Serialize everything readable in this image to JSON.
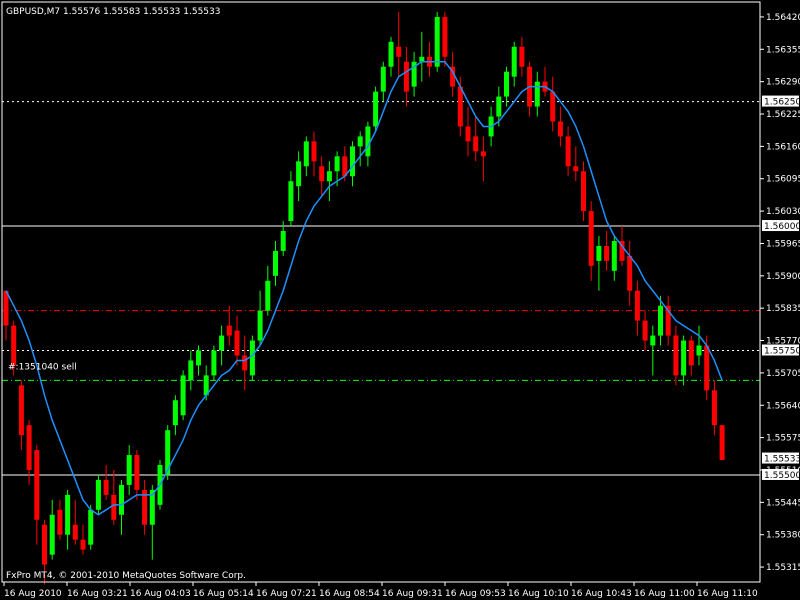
{
  "header": {
    "symbol": "GBPUSD,M7",
    "quote": "1.55576 1.55583 1.55533 1.55533"
  },
  "footer": {
    "copyright": "FxPro MT4, © 2001-2010 MetaQuotes Software Corp."
  },
  "colors": {
    "background": "#000000",
    "bull": "#00ff00",
    "bear": "#ff0000",
    "ma": "#1e90ff",
    "axis": "#ffffff",
    "order_stop": "#ff0000",
    "order_target": "#00ff00"
  },
  "chart_data": {
    "type": "candlestick",
    "symbol": "GBPUSD",
    "timeframe": "M7",
    "ylim": [
      1.555,
      1.5645
    ],
    "y_ticks": [
      "1.56420",
      "1.56355",
      "1.56290",
      "1.56225",
      "1.56160",
      "1.56095",
      "1.56030",
      "1.55965",
      "1.55900",
      "1.55835",
      "1.55770",
      "1.55705",
      "1.55640",
      "1.55575",
      "1.55510",
      "1.55445",
      "1.55380",
      "1.55315"
    ],
    "x_ticks": [
      "16 Aug 2010",
      "16 Aug 03:21",
      "16 Aug 04:03",
      "16 Aug 05:14",
      "16 Aug 07:21",
      "16 Aug 08:54",
      "16 Aug 09:31",
      "16 Aug 09:53",
      "16 Aug 10:10",
      "16 Aug 10:43",
      "16 Aug 11:00",
      "16 Aug 11:10"
    ],
    "price_labels": [
      {
        "text": "1.56250",
        "price": 1.5625,
        "style": "boxed"
      },
      {
        "text": "1.56000",
        "price": 1.56,
        "style": "boxed"
      },
      {
        "text": "1.55750",
        "price": 1.5575,
        "style": "boxed"
      },
      {
        "text": "1.55533",
        "price": 1.55533,
        "style": "boxed"
      },
      {
        "text": "1.55500",
        "price": 1.555,
        "style": "boxed"
      }
    ],
    "hlines": [
      {
        "price": 1.5625,
        "style": "dotted",
        "color": "#ffffff"
      },
      {
        "price": 1.56,
        "style": "solid",
        "color": "#ffffff"
      },
      {
        "price": 1.5583,
        "style": "dashdot",
        "color": "#ff0000"
      },
      {
        "price": 1.5575,
        "style": "dotted",
        "color": "#ffffff"
      },
      {
        "price": 1.5569,
        "style": "dashdot",
        "color": "#00ff00"
      },
      {
        "price": 1.555,
        "style": "solid",
        "color": "#ffffff"
      }
    ],
    "order_label": {
      "text": "#:1351040 sell",
      "price": 1.5571
    },
    "candles": [
      {
        "o": 1.5587,
        "h": 1.5587,
        "l": 1.5577,
        "c": 1.558
      },
      {
        "o": 1.558,
        "h": 1.5581,
        "l": 1.557,
        "c": 1.5572
      },
      {
        "o": 1.5568,
        "h": 1.5569,
        "l": 1.5555,
        "c": 1.5558
      },
      {
        "o": 1.556,
        "h": 1.5561,
        "l": 1.5548,
        "c": 1.5551
      },
      {
        "o": 1.5555,
        "h": 1.5556,
        "l": 1.5536,
        "c": 1.5541
      },
      {
        "o": 1.554,
        "h": 1.5541,
        "l": 1.5528,
        "c": 1.5532
      },
      {
        "o": 1.5534,
        "h": 1.5545,
        "l": 1.5533,
        "c": 1.5542
      },
      {
        "o": 1.5543,
        "h": 1.5545,
        "l": 1.5537,
        "c": 1.5538
      },
      {
        "o": 1.5538,
        "h": 1.5547,
        "l": 1.5535,
        "c": 1.5546
      },
      {
        "o": 1.554,
        "h": 1.5545,
        "l": 1.5536,
        "c": 1.5537
      },
      {
        "o": 1.5537,
        "h": 1.554,
        "l": 1.5534,
        "c": 1.5535
      },
      {
        "o": 1.5536,
        "h": 1.5544,
        "l": 1.5535,
        "c": 1.5543
      },
      {
        "o": 1.5543,
        "h": 1.555,
        "l": 1.5542,
        "c": 1.5549
      },
      {
        "o": 1.5549,
        "h": 1.5552,
        "l": 1.5545,
        "c": 1.5546
      },
      {
        "o": 1.5546,
        "h": 1.5551,
        "l": 1.554,
        "c": 1.5541
      },
      {
        "o": 1.5542,
        "h": 1.5549,
        "l": 1.5538,
        "c": 1.5548
      },
      {
        "o": 1.5548,
        "h": 1.5556,
        "l": 1.5546,
        "c": 1.5554
      },
      {
        "o": 1.5554,
        "h": 1.5555,
        "l": 1.5545,
        "c": 1.5547
      },
      {
        "o": 1.5547,
        "h": 1.5549,
        "l": 1.5538,
        "c": 1.554
      },
      {
        "o": 1.554,
        "h": 1.5548,
        "l": 1.5533,
        "c": 1.5547
      },
      {
        "o": 1.5544,
        "h": 1.5553,
        "l": 1.5543,
        "c": 1.5552
      },
      {
        "o": 1.555,
        "h": 1.556,
        "l": 1.5549,
        "c": 1.5559
      },
      {
        "o": 1.556,
        "h": 1.5566,
        "l": 1.5558,
        "c": 1.5565
      },
      {
        "o": 1.5562,
        "h": 1.5571,
        "l": 1.5561,
        "c": 1.557
      },
      {
        "o": 1.5569,
        "h": 1.5575,
        "l": 1.5567,
        "c": 1.5573
      },
      {
        "o": 1.5572,
        "h": 1.5576,
        "l": 1.557,
        "c": 1.5575
      },
      {
        "o": 1.5566,
        "h": 1.5572,
        "l": 1.5565,
        "c": 1.557
      },
      {
        "o": 1.557,
        "h": 1.5576,
        "l": 1.5569,
        "c": 1.5575
      },
      {
        "o": 1.5575,
        "h": 1.558,
        "l": 1.5572,
        "c": 1.5578
      },
      {
        "o": 1.558,
        "h": 1.5584,
        "l": 1.5576,
        "c": 1.5578
      },
      {
        "o": 1.5579,
        "h": 1.5582,
        "l": 1.5572,
        "c": 1.5574
      },
      {
        "o": 1.5574,
        "h": 1.5578,
        "l": 1.5567,
        "c": 1.5571
      },
      {
        "o": 1.557,
        "h": 1.5578,
        "l": 1.5569,
        "c": 1.5577
      },
      {
        "o": 1.5577,
        "h": 1.5587,
        "l": 1.5576,
        "c": 1.5583
      },
      {
        "o": 1.5583,
        "h": 1.5592,
        "l": 1.5582,
        "c": 1.5589
      },
      {
        "o": 1.559,
        "h": 1.5597,
        "l": 1.5588,
        "c": 1.5595
      },
      {
        "o": 1.5595,
        "h": 1.5601,
        "l": 1.5594,
        "c": 1.5599
      },
      {
        "o": 1.5601,
        "h": 1.5611,
        "l": 1.56,
        "c": 1.5609
      },
      {
        "o": 1.5608,
        "h": 1.5615,
        "l": 1.5605,
        "c": 1.5613
      },
      {
        "o": 1.5612,
        "h": 1.5618,
        "l": 1.561,
        "c": 1.5617
      },
      {
        "o": 1.5617,
        "h": 1.5619,
        "l": 1.561,
        "c": 1.5613
      },
      {
        "o": 1.5612,
        "h": 1.5614,
        "l": 1.5606,
        "c": 1.5609
      },
      {
        "o": 1.5609,
        "h": 1.5613,
        "l": 1.5605,
        "c": 1.5611
      },
      {
        "o": 1.5611,
        "h": 1.5615,
        "l": 1.5608,
        "c": 1.5614
      },
      {
        "o": 1.5614,
        "h": 1.5616,
        "l": 1.5609,
        "c": 1.561
      },
      {
        "o": 1.561,
        "h": 1.5617,
        "l": 1.5608,
        "c": 1.5616
      },
      {
        "o": 1.5616,
        "h": 1.5619,
        "l": 1.5612,
        "c": 1.5618
      },
      {
        "o": 1.5614,
        "h": 1.5621,
        "l": 1.5612,
        "c": 1.562
      },
      {
        "o": 1.562,
        "h": 1.5628,
        "l": 1.5619,
        "c": 1.5627
      },
      {
        "o": 1.5627,
        "h": 1.5633,
        "l": 1.5625,
        "c": 1.5632
      },
      {
        "o": 1.5632,
        "h": 1.5638,
        "l": 1.563,
        "c": 1.5637
      },
      {
        "o": 1.5636,
        "h": 1.5643,
        "l": 1.563,
        "c": 1.5634
      },
      {
        "o": 1.5633,
        "h": 1.5636,
        "l": 1.5624,
        "c": 1.5627
      },
      {
        "o": 1.5628,
        "h": 1.5635,
        "l": 1.5626,
        "c": 1.5633
      },
      {
        "o": 1.5633,
        "h": 1.5639,
        "l": 1.5629,
        "c": 1.5634
      },
      {
        "o": 1.5634,
        "h": 1.5637,
        "l": 1.563,
        "c": 1.5632
      },
      {
        "o": 1.5632,
        "h": 1.5643,
        "l": 1.5631,
        "c": 1.5642
      },
      {
        "o": 1.5642,
        "h": 1.5643,
        "l": 1.5632,
        "c": 1.5634
      },
      {
        "o": 1.5632,
        "h": 1.5635,
        "l": 1.5626,
        "c": 1.5628
      },
      {
        "o": 1.5628,
        "h": 1.563,
        "l": 1.5618,
        "c": 1.562
      },
      {
        "o": 1.562,
        "h": 1.5624,
        "l": 1.5614,
        "c": 1.5617
      },
      {
        "o": 1.5618,
        "h": 1.5622,
        "l": 1.5613,
        "c": 1.5615
      },
      {
        "o": 1.5615,
        "h": 1.5618,
        "l": 1.5609,
        "c": 1.5614
      },
      {
        "o": 1.5618,
        "h": 1.5624,
        "l": 1.5616,
        "c": 1.5622
      },
      {
        "o": 1.5622,
        "h": 1.5628,
        "l": 1.562,
        "c": 1.5626
      },
      {
        "o": 1.5626,
        "h": 1.5632,
        "l": 1.5624,
        "c": 1.5631
      },
      {
        "o": 1.563,
        "h": 1.5637,
        "l": 1.5628,
        "c": 1.5636
      },
      {
        "o": 1.5636,
        "h": 1.5638,
        "l": 1.563,
        "c": 1.5632
      },
      {
        "o": 1.5632,
        "h": 1.5633,
        "l": 1.5622,
        "c": 1.5624
      },
      {
        "o": 1.5624,
        "h": 1.5631,
        "l": 1.5622,
        "c": 1.5629
      },
      {
        "o": 1.5629,
        "h": 1.5632,
        "l": 1.5626,
        "c": 1.5627
      },
      {
        "o": 1.5627,
        "h": 1.563,
        "l": 1.5619,
        "c": 1.5621
      },
      {
        "o": 1.5621,
        "h": 1.5624,
        "l": 1.5616,
        "c": 1.5618
      },
      {
        "o": 1.5618,
        "h": 1.562,
        "l": 1.561,
        "c": 1.5612
      },
      {
        "o": 1.5612,
        "h": 1.5616,
        "l": 1.5609,
        "c": 1.5611
      },
      {
        "o": 1.5611,
        "h": 1.5613,
        "l": 1.5601,
        "c": 1.5603
      },
      {
        "o": 1.5603,
        "h": 1.5605,
        "l": 1.5589,
        "c": 1.5592
      },
      {
        "o": 1.5593,
        "h": 1.5598,
        "l": 1.5587,
        "c": 1.5596
      },
      {
        "o": 1.5596,
        "h": 1.5599,
        "l": 1.5591,
        "c": 1.5593
      },
      {
        "o": 1.5591,
        "h": 1.5598,
        "l": 1.5589,
        "c": 1.5597
      },
      {
        "o": 1.5597,
        "h": 1.56,
        "l": 1.5592,
        "c": 1.5593
      },
      {
        "o": 1.5594,
        "h": 1.5597,
        "l": 1.5584,
        "c": 1.5587
      },
      {
        "o": 1.5587,
        "h": 1.5589,
        "l": 1.5578,
        "c": 1.5581
      },
      {
        "o": 1.5581,
        "h": 1.5583,
        "l": 1.5575,
        "c": 1.5577
      },
      {
        "o": 1.5576,
        "h": 1.558,
        "l": 1.557,
        "c": 1.5578
      },
      {
        "o": 1.5578,
        "h": 1.5586,
        "l": 1.5576,
        "c": 1.5584
      },
      {
        "o": 1.5584,
        "h": 1.5586,
        "l": 1.5576,
        "c": 1.5578
      },
      {
        "o": 1.5578,
        "h": 1.558,
        "l": 1.5568,
        "c": 1.557
      },
      {
        "o": 1.557,
        "h": 1.5578,
        "l": 1.5568,
        "c": 1.5577
      },
      {
        "o": 1.5577,
        "h": 1.5578,
        "l": 1.557,
        "c": 1.5572
      },
      {
        "o": 1.5574,
        "h": 1.558,
        "l": 1.5572,
        "c": 1.5576
      },
      {
        "o": 1.5576,
        "h": 1.5578,
        "l": 1.5565,
        "c": 1.5567
      },
      {
        "o": 1.5567,
        "h": 1.5569,
        "l": 1.5558,
        "c": 1.556
      },
      {
        "o": 1.556,
        "h": 1.556,
        "l": 1.5553,
        "c": 1.5553
      }
    ],
    "ma": [
      1.5587,
      1.5584,
      1.5581,
      1.5577,
      1.5572,
      1.5566,
      1.5561,
      1.5557,
      1.5553,
      1.5549,
      1.5545,
      1.5543,
      1.5542,
      1.5543,
      1.5544,
      1.5544,
      1.5545,
      1.5546,
      1.5546,
      1.5546,
      1.5548,
      1.5551,
      1.5554,
      1.5557,
      1.5561,
      1.5564,
      1.5566,
      1.5568,
      1.557,
      1.5571,
      1.5573,
      1.5573,
      1.5574,
      1.5576,
      1.5579,
      1.5583,
      1.5587,
      1.5592,
      1.5597,
      1.5601,
      1.5604,
      1.5606,
      1.5608,
      1.5609,
      1.561,
      1.5612,
      1.5614,
      1.5616,
      1.5619,
      1.5623,
      1.5627,
      1.563,
      1.5631,
      1.5632,
      1.5633,
      1.5633,
      1.5633,
      1.5633,
      1.5631,
      1.5628,
      1.5625,
      1.5622,
      1.562,
      1.562,
      1.5621,
      1.5623,
      1.5625,
      1.5627,
      1.5628,
      1.5628,
      1.5628,
      1.5627,
      1.5625,
      1.5623,
      1.562,
      1.5616,
      1.5611,
      1.5606,
      1.5601,
      1.5598,
      1.5596,
      1.5594,
      1.5592,
      1.5589,
      1.5587,
      1.5585,
      1.5583,
      1.5581,
      1.558,
      1.5579,
      1.5578,
      1.5576,
      1.5573,
      1.5569
    ]
  }
}
